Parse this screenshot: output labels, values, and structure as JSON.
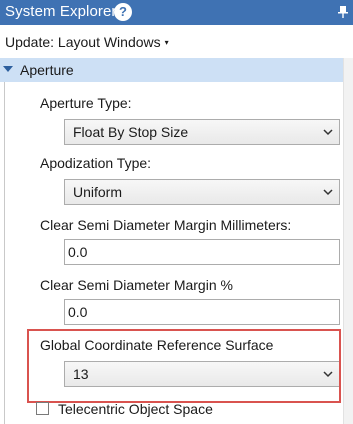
{
  "window": {
    "title": "System Explorer",
    "help_glyph": "?",
    "pin_icon": "pin-icon"
  },
  "toolbar": {
    "update_label": "Update: Layout Windows",
    "update_caret": "▾"
  },
  "section": {
    "label": "Aperture",
    "expanded": true
  },
  "fields": {
    "aperture_type": {
      "label": "Aperture Type:",
      "value": "Float By Stop Size"
    },
    "apodization_type": {
      "label": "Apodization Type:",
      "value": "Uniform"
    },
    "clear_semi_diameter_mm": {
      "label": "Clear Semi Diameter Margin Millimeters:",
      "value": "0.0"
    },
    "clear_semi_diameter_pct": {
      "label": "Clear Semi Diameter Margin %",
      "value": "0.0"
    },
    "global_coord_ref_surface": {
      "label": "Global Coordinate Reference Surface",
      "value": "13"
    },
    "telecentric_object_space": {
      "label": "Telecentric Object Space",
      "checked": false
    }
  },
  "colors": {
    "titlebar": "#3f72b3",
    "section_header": "#cde0f5",
    "highlight_border": "#d9534f"
  }
}
